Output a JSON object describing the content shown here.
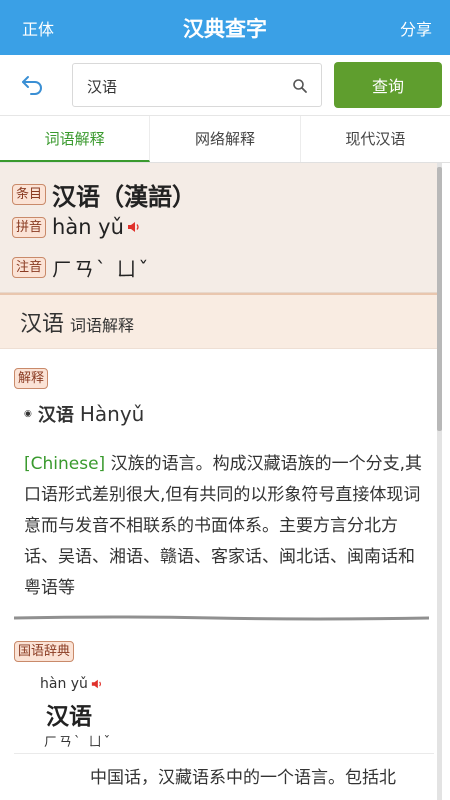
{
  "topbar": {
    "left_label": "正体",
    "title": "汉典查字",
    "right_label": "分享"
  },
  "search": {
    "value": "汉语",
    "button_label": "查询"
  },
  "tabs": [
    {
      "label": "词语解释",
      "active": true
    },
    {
      "label": "网络解释",
      "active": false
    },
    {
      "label": "现代汉语",
      "active": false
    }
  ],
  "entry": {
    "tag_term": "条目",
    "term": "汉语（漢語）",
    "tag_pinyin": "拼音",
    "pinyin": "hàn yǔ",
    "tag_zhuyin": "注音",
    "zhuyin": "ㄏㄢˋ ㄩˇ"
  },
  "section": {
    "word": "汉语",
    "subtitle": "词语解释"
  },
  "explanation": {
    "tag": "解释",
    "word": "汉语",
    "pinyin_en": "Hànyǔ",
    "english": "[Chinese]",
    "definition": " 汉族的语言。构成汉藏语族的一个分支,其口语形式差别很大,但有共同的以形象符号直接体现词意而与发音不相联系的书面体系。主要方言分北方话、吴语、湘语、赣语、客家话、闽北话、闽南话和粤语等"
  },
  "guoyu": {
    "tag": "国语辞典",
    "pinyin": "hàn yǔ",
    "word": "汉语",
    "zhuyin": "ㄏㄢˋ ㄩˇ",
    "definition": "中国话，汉藏语系中的一个语言。包括北"
  },
  "colors": {
    "topbar": "#3aa0e6",
    "query_button": "#5f9e2e",
    "active_tab": "#3a9a2e",
    "tag_text": "#8a3b22",
    "sound_icon": "#e0312b"
  }
}
